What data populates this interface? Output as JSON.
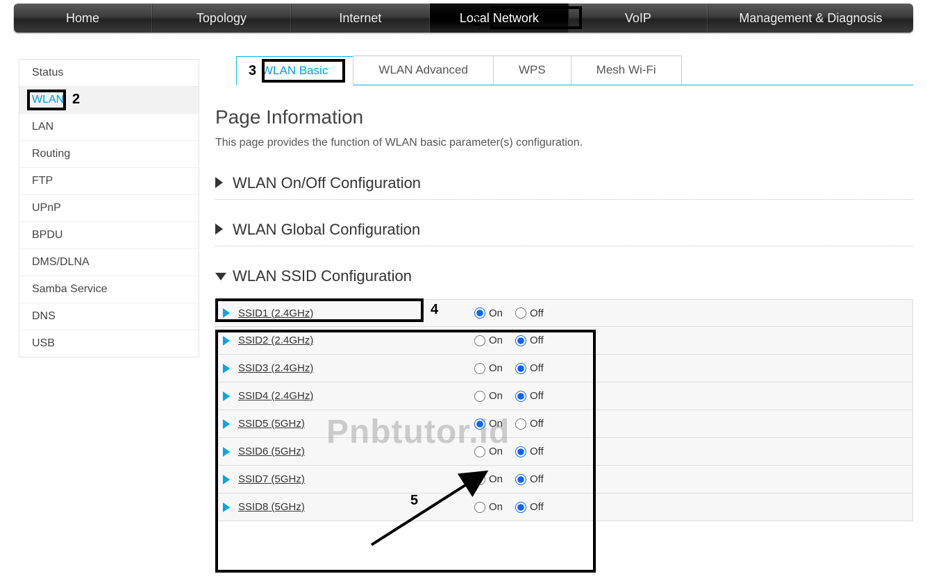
{
  "topnav": {
    "items": [
      {
        "label": "Home"
      },
      {
        "label": "Topology"
      },
      {
        "label": "Internet"
      },
      {
        "label": "Local Network",
        "active": true
      },
      {
        "label": "VoIP"
      },
      {
        "label": "Management & Diagnosis"
      }
    ]
  },
  "sidebar": {
    "items": [
      {
        "label": "Status"
      },
      {
        "label": "WLAN",
        "active": true
      },
      {
        "label": "LAN"
      },
      {
        "label": "Routing"
      },
      {
        "label": "FTP"
      },
      {
        "label": "UPnP"
      },
      {
        "label": "BPDU"
      },
      {
        "label": "DMS/DLNA"
      },
      {
        "label": "Samba Service"
      },
      {
        "label": "DNS"
      },
      {
        "label": "USB"
      }
    ]
  },
  "tabs": [
    {
      "label": "WLAN Basic",
      "active": true
    },
    {
      "label": "WLAN Advanced"
    },
    {
      "label": "WPS"
    },
    {
      "label": "Mesh Wi-Fi"
    }
  ],
  "page": {
    "title": "Page Information",
    "description": "This page provides the function of WLAN basic parameter(s) configuration."
  },
  "sections": {
    "onoff": {
      "title": "WLAN On/Off Configuration",
      "expanded": false
    },
    "global": {
      "title": "WLAN Global Configuration",
      "expanded": false
    },
    "ssid": {
      "title": "WLAN SSID Configuration",
      "expanded": true
    }
  },
  "radios": {
    "on_label": "On",
    "off_label": "Off"
  },
  "ssids": [
    {
      "label": "SSID1 (2.4GHz)",
      "state": "on"
    },
    {
      "label": "SSID2 (2.4GHz)",
      "state": "off"
    },
    {
      "label": "SSID3 (2.4GHz)",
      "state": "off"
    },
    {
      "label": "SSID4 (2.4GHz)",
      "state": "off"
    },
    {
      "label": "SSID5 (5GHz)",
      "state": "on"
    },
    {
      "label": "SSID6 (5GHz)",
      "state": "off"
    },
    {
      "label": "SSID7 (5GHz)",
      "state": "off"
    },
    {
      "label": "SSID8 (5GHz)",
      "state": "off"
    }
  ],
  "annotations": {
    "num1": "1",
    "num2": "2",
    "num3": "3",
    "num4": "4",
    "num5": "5"
  },
  "watermark": "Pnbtutor.id"
}
